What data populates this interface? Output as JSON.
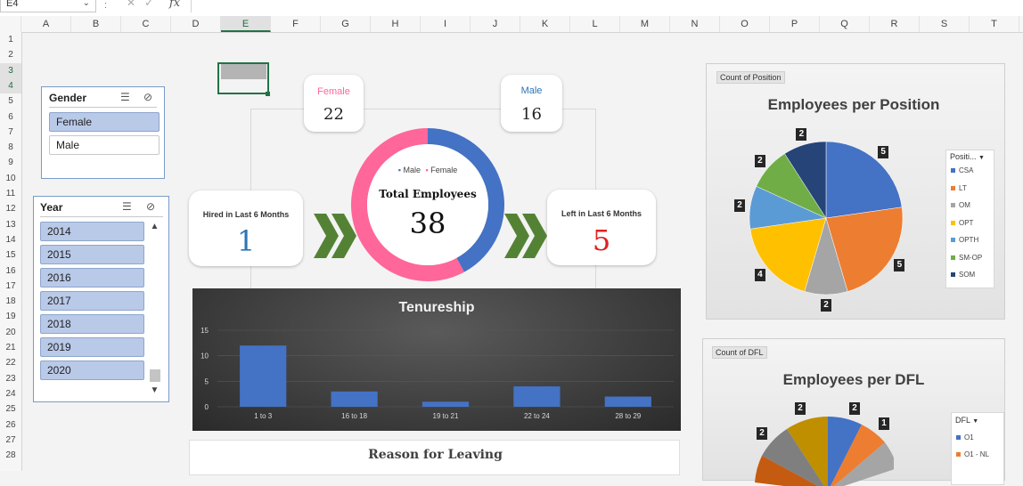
{
  "formula_bar": {
    "name_box": "E4",
    "separator": ":",
    "cancel_icon": "✕",
    "enter_icon": "✓",
    "fx": "fx",
    "value": ""
  },
  "columns": [
    "A",
    "B",
    "C",
    "D",
    "E",
    "F",
    "G",
    "H",
    "I",
    "J",
    "K",
    "L",
    "M",
    "N",
    "O",
    "P",
    "Q",
    "R",
    "S",
    "T"
  ],
  "selected_column": "E",
  "rows": [
    "1",
    "2",
    "3",
    "4",
    "5",
    "6",
    "7",
    "8",
    "9",
    "10",
    "11",
    "12",
    "13",
    "14",
    "15",
    "16",
    "17",
    "18",
    "19",
    "20",
    "21",
    "22",
    "23",
    "24",
    "25",
    "26",
    "27",
    "28"
  ],
  "selected_rows": [
    "3",
    "4"
  ],
  "gender_slicer": {
    "title": "Gender",
    "multi_select_icon": "☰",
    "clear_filter_icon": "⊘",
    "items": [
      {
        "label": "Female",
        "selected": true
      },
      {
        "label": "Male",
        "selected": false
      }
    ]
  },
  "year_slicer": {
    "title": "Year",
    "items": [
      {
        "label": "2014",
        "selected": true
      },
      {
        "label": "2015",
        "selected": true
      },
      {
        "label": "2016",
        "selected": true
      },
      {
        "label": "2017",
        "selected": true
      },
      {
        "label": "2018",
        "selected": true
      },
      {
        "label": "2019",
        "selected": true
      },
      {
        "label": "2020",
        "selected": true
      }
    ],
    "scroll_up": "▲",
    "scroll_down": "▼"
  },
  "gender_cards": {
    "female": {
      "label": "Female",
      "value": "22"
    },
    "male": {
      "label": "Male",
      "value": "16"
    }
  },
  "hired_card": {
    "label": "Hired in Last 6 Months",
    "value": "1"
  },
  "left_card": {
    "label": "Left in Last 6 Months",
    "value": "5"
  },
  "donut": {
    "legend_male": "Male",
    "legend_female": "Female",
    "title": "Total Employees",
    "total": "38",
    "male_value": 16,
    "female_value": 22,
    "male_color": "#4472c4",
    "female_color": "#ff6699"
  },
  "arrow_color": "#548235",
  "position_chart": {
    "pivot_tag": "Count of Position",
    "title": "Employees per Position",
    "legend_header": "Positi...",
    "chart_data": {
      "type": "pie",
      "title": "Employees per Position",
      "categories": [
        "CSA",
        "LT",
        "OM",
        "OPT",
        "OPTH",
        "SM-OP",
        "SOM"
      ],
      "values": [
        5,
        5,
        2,
        4,
        2,
        2,
        2
      ],
      "colors": [
        "#4472c4",
        "#ed7d31",
        "#a5a5a5",
        "#ffc000",
        "#5b9bd5",
        "#70ad47",
        "#264478"
      ]
    }
  },
  "dfl_chart": {
    "pivot_tag": "Count of DFL",
    "title": "Employees per DFL",
    "legend_header": "DFL",
    "legend_items": [
      "O1",
      "O1 - NL"
    ],
    "visible_labels": [
      "2",
      "2",
      "1",
      "2"
    ]
  },
  "tenure_chart": {
    "chart_data": {
      "type": "bar",
      "title": "Tenureship",
      "categories": [
        "1 to 3",
        "16 to 18",
        "19 to 21",
        "22 to 24",
        "28 to 29"
      ],
      "values": [
        12,
        3,
        1,
        4,
        2
      ],
      "ylim": [
        0,
        15
      ],
      "yticks": [
        "0",
        "5",
        "10",
        "15"
      ],
      "bar_color": "#4472c4"
    }
  },
  "leaving_chart": {
    "title": "Reason for Leaving"
  }
}
